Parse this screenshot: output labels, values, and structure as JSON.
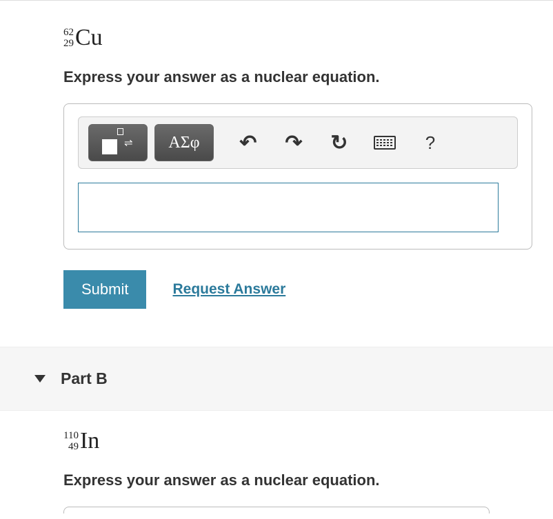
{
  "partA": {
    "isotope": {
      "mass": "62",
      "atomic": "29",
      "symbol": "Cu"
    },
    "instruction": "Express your answer as a nuclear equation.",
    "toolbar": {
      "greek_label": "ΑΣφ",
      "undo": "↶",
      "redo": "↷",
      "reset": "↻",
      "help": "?"
    },
    "answer_value": "",
    "submit_label": "Submit",
    "request_label": "Request Answer"
  },
  "partB": {
    "title": "Part B",
    "isotope": {
      "mass": "110",
      "atomic": "49",
      "symbol": "In"
    },
    "instruction": "Express your answer as a nuclear equation."
  }
}
